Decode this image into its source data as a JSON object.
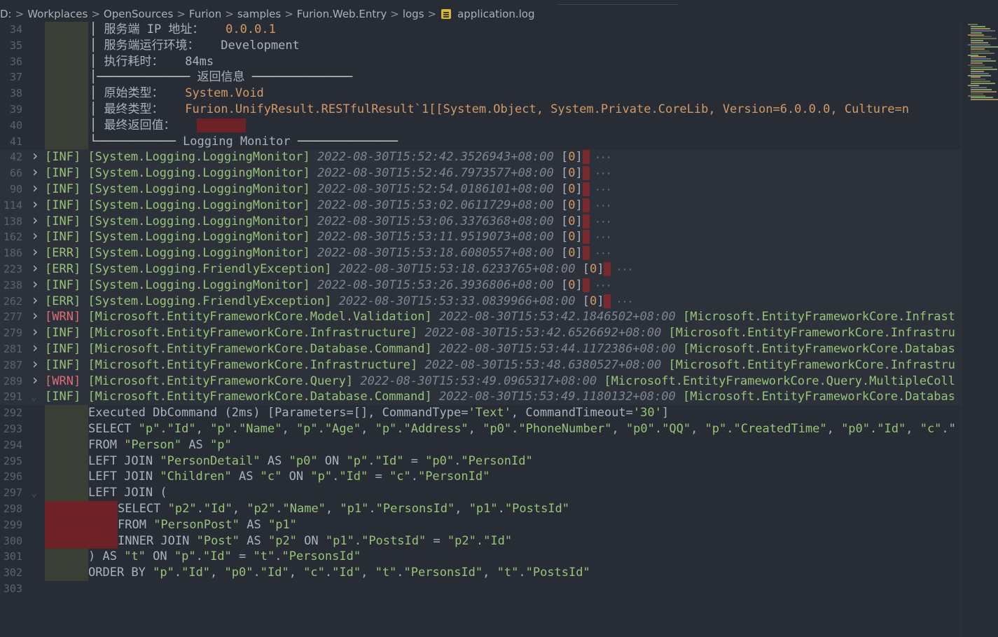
{
  "breadcrumb": {
    "segments": [
      "D:",
      "Workplaces",
      "OpenSources",
      "Furion",
      "samples",
      "Furion.Web.Entry",
      "logs"
    ],
    "file": "application.log",
    "separator": ">"
  },
  "header_lines": [
    {
      "ln": "34",
      "label": "服务端 IP 地址：",
      "value": "0.0.0.1"
    },
    {
      "ln": "35",
      "label": "服务端运行环境：",
      "value": "Development"
    },
    {
      "ln": "36",
      "label": "执行耗时：",
      "value": "84ms"
    },
    {
      "ln": "37",
      "section": "返回信息"
    },
    {
      "ln": "38",
      "label": "原始类型：",
      "value": "System.Void"
    },
    {
      "ln": "39",
      "label": "最终类型：",
      "value_parts": [
        "Furion.UnifyResult.RESTfulResult`1[[System.Object, System.Private.CoreLib, Version=",
        "6.0.0.0",
        ", Culture=n"
      ]
    },
    {
      "ln": "40",
      "label": "最终返回值："
    },
    {
      "ln": "41",
      "section": "Logging Monitor"
    }
  ],
  "log_entries": [
    {
      "ln": "42",
      "level": "[INF]",
      "category": "[System.Logging.LoggingMonitor]",
      "timestamp": "2022-08-30T15:52:42.3526943+08:00",
      "tail": "[0]"
    },
    {
      "ln": "66",
      "level": "[INF]",
      "category": "[System.Logging.LoggingMonitor]",
      "timestamp": "2022-08-30T15:52:46.7973577+08:00",
      "tail": "[0]"
    },
    {
      "ln": "90",
      "level": "[INF]",
      "category": "[System.Logging.LoggingMonitor]",
      "timestamp": "2022-08-30T15:52:54.0186101+08:00",
      "tail": "[0]"
    },
    {
      "ln": "114",
      "level": "[INF]",
      "category": "[System.Logging.LoggingMonitor]",
      "timestamp": "2022-08-30T15:53:02.0611729+08:00",
      "tail": "[0]"
    },
    {
      "ln": "138",
      "level": "[INF]",
      "category": "[System.Logging.LoggingMonitor]",
      "timestamp": "2022-08-30T15:53:06.3376368+08:00",
      "tail": "[0]"
    },
    {
      "ln": "162",
      "level": "[INF]",
      "category": "[System.Logging.LoggingMonitor]",
      "timestamp": "2022-08-30T15:53:11.9519073+08:00",
      "tail": "[0]"
    },
    {
      "ln": "186",
      "level": "[ERR]",
      "category": "[System.Logging.LoggingMonitor]",
      "timestamp": "2022-08-30T15:53:18.6080557+08:00",
      "tail": "[0]"
    },
    {
      "ln": "223",
      "level": "[ERR]",
      "category": "[System.Logging.FriendlyException]",
      "timestamp": "2022-08-30T15:53:18.6233765+08:00",
      "tail": "[0]"
    },
    {
      "ln": "238",
      "level": "[INF]",
      "category": "[System.Logging.LoggingMonitor]",
      "timestamp": "2022-08-30T15:53:26.3936806+08:00",
      "tail": "[0]"
    },
    {
      "ln": "262",
      "level": "[ERR]",
      "category": "[System.Logging.FriendlyException]",
      "timestamp": "2022-08-30T15:53:33.0839966+08:00",
      "tail": "[0]"
    },
    {
      "ln": "277",
      "level": "[WRN]",
      "category": "[Microsoft.EntityFrameworkCore.Model.Validation]",
      "timestamp": "2022-08-30T15:53:42.1846502+08:00",
      "tail": "[Microsoft.EntityFrameworkCore.Infrast"
    },
    {
      "ln": "279",
      "level": "[INF]",
      "category": "[Microsoft.EntityFrameworkCore.Infrastructure]",
      "timestamp": "2022-08-30T15:53:42.6526692+08:00",
      "tail": "[Microsoft.EntityFrameworkCore.Infrastru"
    },
    {
      "ln": "281",
      "level": "[INF]",
      "category": "[Microsoft.EntityFrameworkCore.Database.Command]",
      "timestamp": "2022-08-30T15:53:44.1172386+08:00",
      "tail": "[Microsoft.EntityFrameworkCore.Databas"
    },
    {
      "ln": "287",
      "level": "[INF]",
      "category": "[Microsoft.EntityFrameworkCore.Infrastructure]",
      "timestamp": "2022-08-30T15:53:48.6380527+08:00",
      "tail": "[Microsoft.EntityFrameworkCore.Infrastru"
    },
    {
      "ln": "289",
      "level": "[WRN]",
      "category": "[Microsoft.EntityFrameworkCore.Query]",
      "timestamp": "2022-08-30T15:53:49.0965317+08:00",
      "tail": "[Microsoft.EntityFrameworkCore.Query.MultipleColl"
    },
    {
      "ln": "291",
      "level": "[INF]",
      "category": "[Microsoft.EntityFrameworkCore.Database.Command]",
      "timestamp": "2022-08-30T15:53:49.1180132+08:00",
      "tail": "[Microsoft.EntityFrameworkCore.Databas"
    }
  ],
  "sql_lines": [
    {
      "ln": "292",
      "text": "Executed DbCommand (2ms) [Parameters=[], CommandType='Text', CommandTimeout='30']"
    },
    {
      "ln": "293",
      "text": "SELECT \"p\".\"Id\", \"p\".\"Name\", \"p\".\"Age\", \"p\".\"Address\", \"p0\".\"PhoneNumber\", \"p0\".\"QQ\", \"p\".\"CreatedTime\", \"p0\".\"Id\", \"c\".\""
    },
    {
      "ln": "294",
      "text": "FROM \"Person\" AS \"p\""
    },
    {
      "ln": "295",
      "text": "LEFT JOIN \"PersonDetail\" AS \"p0\" ON \"p\".\"Id\" = \"p0\".\"PersonId\""
    },
    {
      "ln": "296",
      "text": "LEFT JOIN \"Children\" AS \"c\" ON \"p\".\"Id\" = \"c\".\"PersonId\""
    },
    {
      "ln": "297",
      "text": "LEFT JOIN ("
    },
    {
      "ln": "298",
      "text": "SELECT \"p2\".\"Id\", \"p2\".\"Name\", \"p1\".\"PersonsId\", \"p1\".\"PostsId\""
    },
    {
      "ln": "299",
      "text": "FROM \"PersonPost\" AS \"p1\""
    },
    {
      "ln": "300",
      "text": "INNER JOIN \"Post\" AS \"p2\" ON \"p1\".\"PostsId\" = \"p2\".\"Id\""
    },
    {
      "ln": "301",
      "text": ") AS \"t\" ON \"p\".\"Id\" = \"t\".\"PersonsId\""
    },
    {
      "ln": "302",
      "text": "ORDER BY \"p\".\"Id\", \"p0\".\"Id\", \"c\".\"Id\", \"t\".\"PersonsId\", \"t\".\"PostsId\""
    },
    {
      "ln": "303",
      "text": ""
    }
  ],
  "colors": {
    "background": "#282c34",
    "string": "#98c379",
    "number": "#d19a66",
    "warn": "#e06c75",
    "comment": "#7f848e",
    "redacted": "#6d2227"
  }
}
